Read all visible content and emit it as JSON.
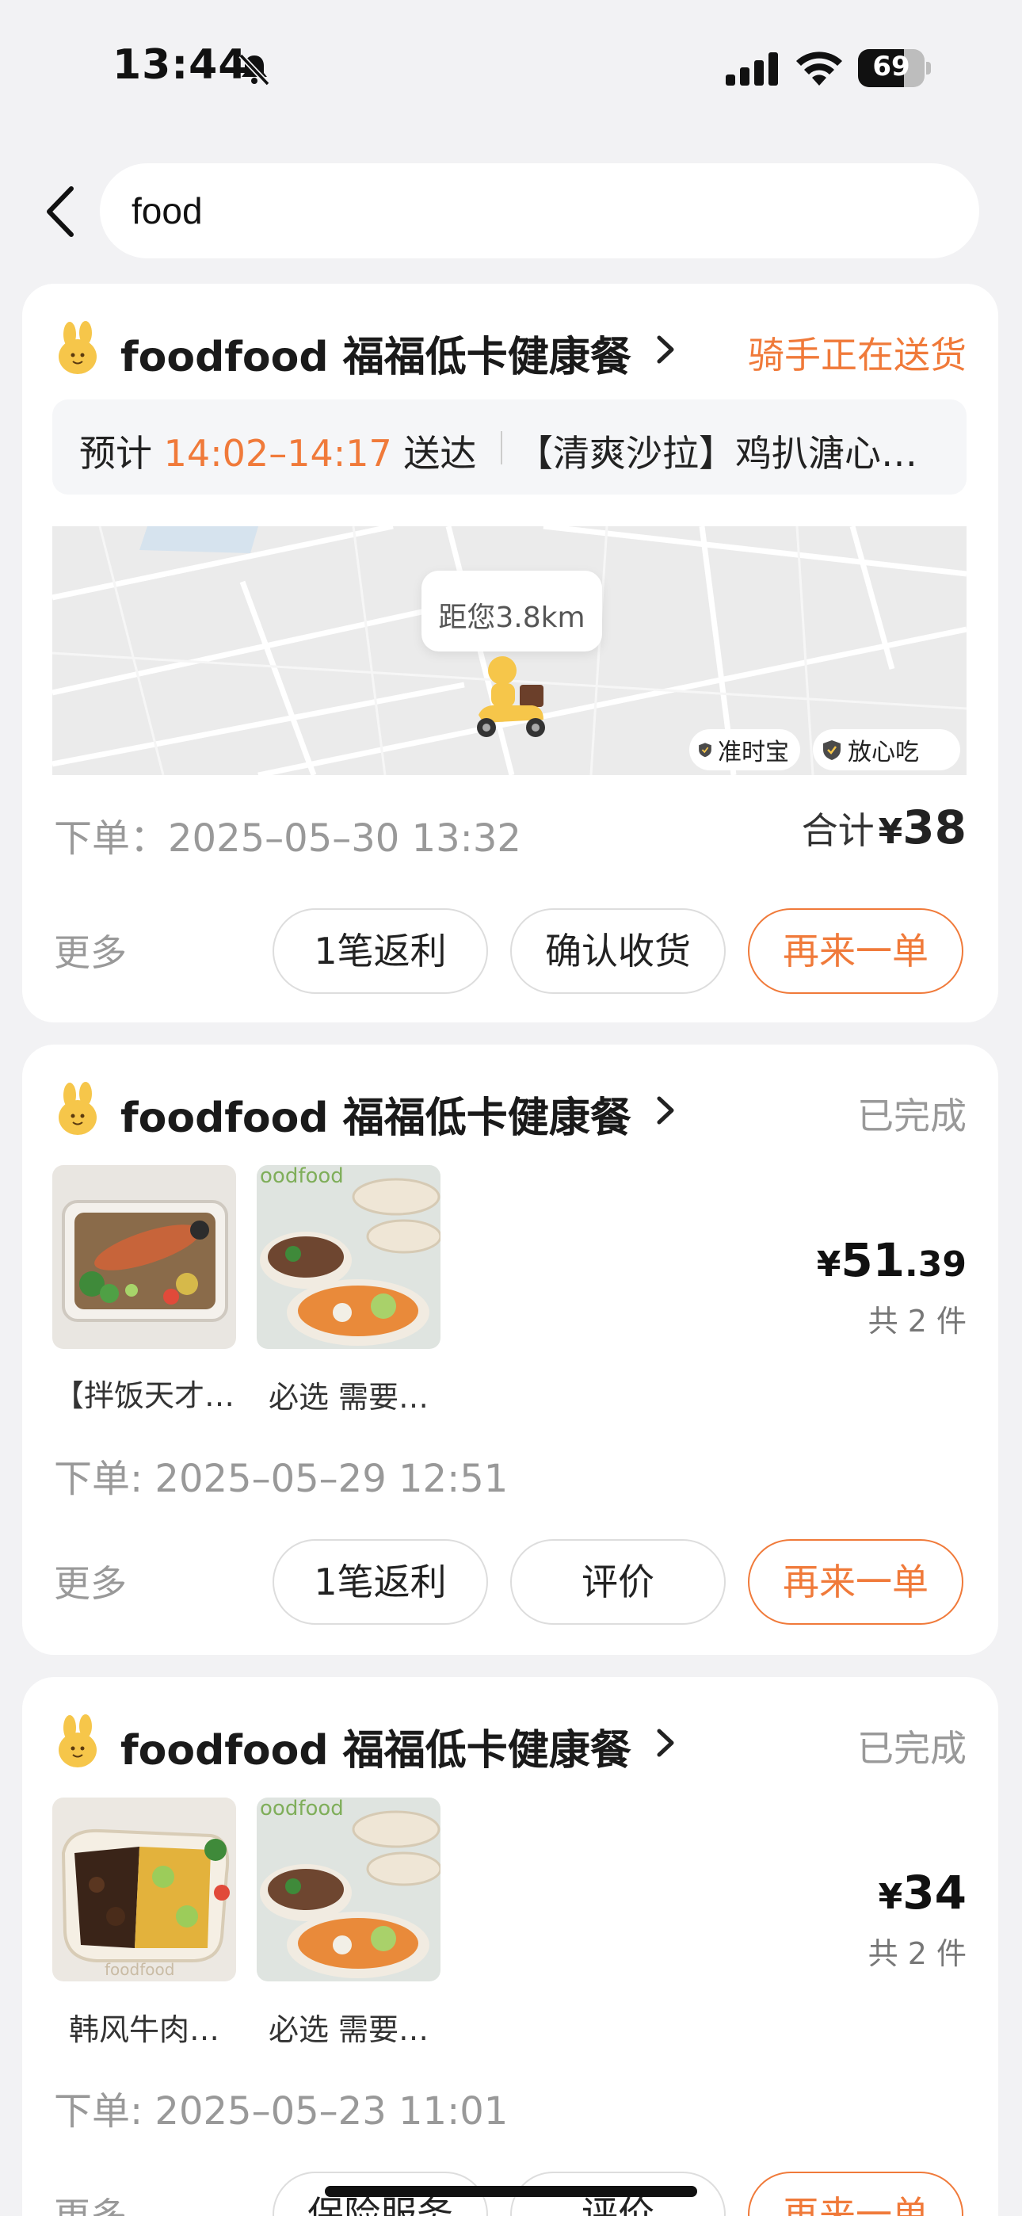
{
  "status_bar": {
    "time": "13:44",
    "battery": "69",
    "battery_level": 0.69
  },
  "search": {
    "value": "food",
    "placeholder": ""
  },
  "colors": {
    "accent": "#f07a3a",
    "muted": "#999999",
    "background": "#f2f2f4"
  },
  "orders": [
    {
      "store_name": "foodfood 福福低卡健康餐",
      "status": "骑手正在送货",
      "eta_prefix": "预计",
      "eta_time": "14:02–14:17",
      "eta_suffix": "送达",
      "eta_item": "【清爽沙拉】鸡扒溏心…",
      "distance": "距您3.8km",
      "badges": [
        "准时宝",
        "放心吃"
      ],
      "order_date": "下单：2025–05–30 13:32",
      "total_label": "合计",
      "total_currency": "¥",
      "total_value": "38",
      "more": "更多",
      "actions": [
        "1笔返利",
        "确认收货",
        "再来一单"
      ]
    },
    {
      "store_name": "foodfood 福福低卡健康餐",
      "status": "已完成",
      "items": [
        {
          "caption": "【拌饭天才…",
          "image": "salmon-rice-bowl"
        },
        {
          "caption": "必选 需要…",
          "image": "foodfood-packaging"
        }
      ],
      "price_currency": "¥",
      "price_int": "51",
      "price_dec": ".39",
      "item_count": "共 2 件",
      "order_date": "下单: 2025–05–29 12:51",
      "more": "更多",
      "actions": [
        "1笔返利",
        "评价",
        "再来一单"
      ]
    },
    {
      "store_name": "foodfood 福福低卡健康餐",
      "status": "已完成",
      "items": [
        {
          "caption": "韩风牛肉…",
          "image": "beef-egg-bowl"
        },
        {
          "caption": "必选 需要…",
          "image": "foodfood-packaging"
        }
      ],
      "price_currency": "¥",
      "price_int": "34",
      "price_dec": "",
      "item_count": "共 2 件",
      "order_date": "下单: 2025–05–23 11:01",
      "more": "更多",
      "actions": [
        "保险服务",
        "评价",
        "再来一单"
      ]
    }
  ]
}
